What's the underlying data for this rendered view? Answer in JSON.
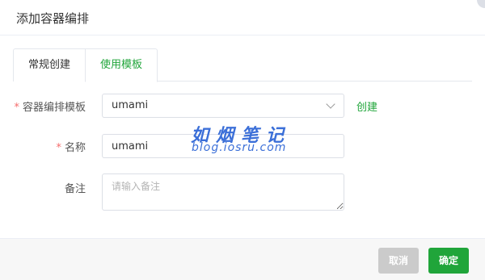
{
  "dialog": {
    "title": "添加容器编排"
  },
  "tabs": [
    {
      "label": "常规创建",
      "active": false
    },
    {
      "label": "使用模板",
      "active": true
    }
  ],
  "form": {
    "template": {
      "label": "容器编排模板",
      "required_mark": "*",
      "value": "umami",
      "create_link": "创建"
    },
    "name": {
      "label": "名称",
      "required_mark": "*",
      "value": "umami"
    },
    "remark": {
      "label": "备注",
      "placeholder": "请输入备注"
    }
  },
  "watermark": {
    "title": "如烟笔记",
    "url": "blog.iosru.com"
  },
  "footer": {
    "cancel_label": "取消",
    "ok_label": "确定"
  },
  "colors": {
    "accent": "#20a53a",
    "required": "#f56c6c",
    "watermark": "#3b6fd8",
    "cancel_bg": "#cbcbcb"
  },
  "icons": {
    "select_arrow": "chevron-down-icon"
  }
}
